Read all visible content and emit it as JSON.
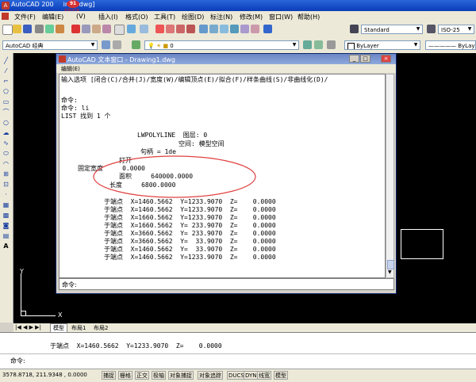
{
  "app": {
    "title": "AutoCAD 200",
    "title_suffix": "ing1.dwg]",
    "badge": "91",
    "badge_text": "点我加速",
    "accent": "#1a46c8"
  },
  "menu": [
    {
      "id": "file",
      "label": "文件(F)"
    },
    {
      "id": "edit",
      "label": "编辑(E)"
    },
    {
      "id": "view",
      "label": "(V)"
    },
    {
      "id": "insert",
      "label": "插入(I)"
    },
    {
      "id": "format",
      "label": "格式(O)"
    },
    {
      "id": "tools",
      "label": "工具(T)"
    },
    {
      "id": "draw",
      "label": "绘图(D)"
    },
    {
      "id": "dimension",
      "label": "标注(N)"
    },
    {
      "id": "modify",
      "label": "修改(M)"
    },
    {
      "id": "window",
      "label": "窗口(W)"
    },
    {
      "id": "help",
      "label": "帮助(H)"
    }
  ],
  "toolbar": {
    "text_style": "Standard",
    "dim_style": "ISO-25",
    "workspace": "AutoCAD 经典",
    "layer": "0",
    "color": "ByLayer",
    "linetype": "ByLay"
  },
  "text_window": {
    "title": "AutoCAD 文本窗口 - Drawing1.dwg",
    "menu_label": "编辑(E)",
    "lines": [
      "输入选项 [闭合(C)/合并(J)/宽度(W)/编辑顶点(E)/拟合(F)/样条曲线(S)/非曲线化(D)/",
      "命令:",
      "命令: li",
      "LIST 找到 1 个",
      "LWPOLYLINE  图层: 0",
      "空间: 模型空间",
      "句柄 = 1de",
      "打开",
      "固定宽度     0.0000",
      "面积     640000.0000",
      "长度     6800.0000",
      "于端点  X=1460.5662  Y=1233.9070  Z=    0.0000",
      "于端点  X=1460.5662  Y=1233.9070  Z=    0.0000",
      "于端点  X=1660.5662  Y=1233.9070  Z=    0.0000",
      "于端点  X=1660.5662  Y= 233.9070  Z=    0.0000",
      "于端点  X=3660.5662  Y= 233.9070  Z=    0.0000",
      "于端点  X=3660.5662  Y=  33.9070  Z=    0.0000",
      "于端点  X=1460.5662  Y=  33.9070  Z=    0.0000",
      "于端点  X=1460.5662  Y=1233.9070  Z=    0.0000"
    ],
    "command_prompt": "命令:"
  },
  "layout_tabs": [
    {
      "id": "model",
      "label": "模型"
    },
    {
      "id": "layout1",
      "label": "布局1"
    },
    {
      "id": "layout2",
      "label": "布局2"
    }
  ],
  "axis": {
    "y": "Y",
    "x": "X"
  },
  "command_area": {
    "line1": "于端点  X=1460.5662  Y=1233.9070  Z=    0.0000",
    "prompt": "命令:"
  },
  "status": {
    "coords": "3578.8718, 211.9348 , 0.0000",
    "buttons": [
      "捕捉",
      "栅格",
      "正交",
      "极轴",
      "对象捕捉",
      "对象追踪",
      "DUCS",
      "DYN",
      "线宽",
      "模型"
    ]
  }
}
